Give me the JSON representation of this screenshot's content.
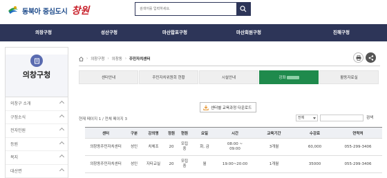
{
  "header": {
    "logo_text": "동북아 중심도시",
    "logo_script": "창원",
    "search_placeholder": "검색어를 입력하세요."
  },
  "nav": {
    "items": [
      "의창구청",
      "성산구청",
      "마산합포구청",
      "마산회원구청",
      "진해구청"
    ]
  },
  "sidebar": {
    "title": "의창구청",
    "items": [
      "의창구 소개",
      "구정소식",
      "전자민원",
      "등원",
      "복지",
      "대산면"
    ]
  },
  "breadcrumb": {
    "items": [
      "의창구청",
      "의창동",
      "주민자치센터"
    ]
  },
  "tabs": [
    "센터안내",
    "주민자치위원회 현황",
    "시설안내",
    "강좌",
    "활동자료실"
  ],
  "active_tab_index": 3,
  "download_label": "센터별 교육과정 다운로드",
  "page_info": "현재 페이지 1 / 전체 페이지 3",
  "filter": {
    "select_value": "전체",
    "search_label": "검색"
  },
  "table": {
    "headers": [
      "센터",
      "구분",
      "강의명",
      "정원",
      "현원",
      "요일",
      "시간",
      "교육기간",
      "수강료",
      "연락처"
    ],
    "rows": [
      [
        "의창동주민자치센터",
        "성인",
        "치체조",
        "20",
        "모집\n중",
        "화, 금",
        "08:00 ~\n09:00",
        "3개월",
        "60,000",
        "055-299-3406"
      ],
      [
        "의창동주민자치센터",
        "성인",
        "지타교실",
        "20",
        "모집\n중",
        "월",
        "19:00~20:00",
        "1개월",
        "35000",
        "055-299-3406"
      ]
    ]
  },
  "colors": {
    "nav_bg": "#2d3558",
    "active_tab": "#1f8a4c",
    "share_btn": "#555555"
  }
}
